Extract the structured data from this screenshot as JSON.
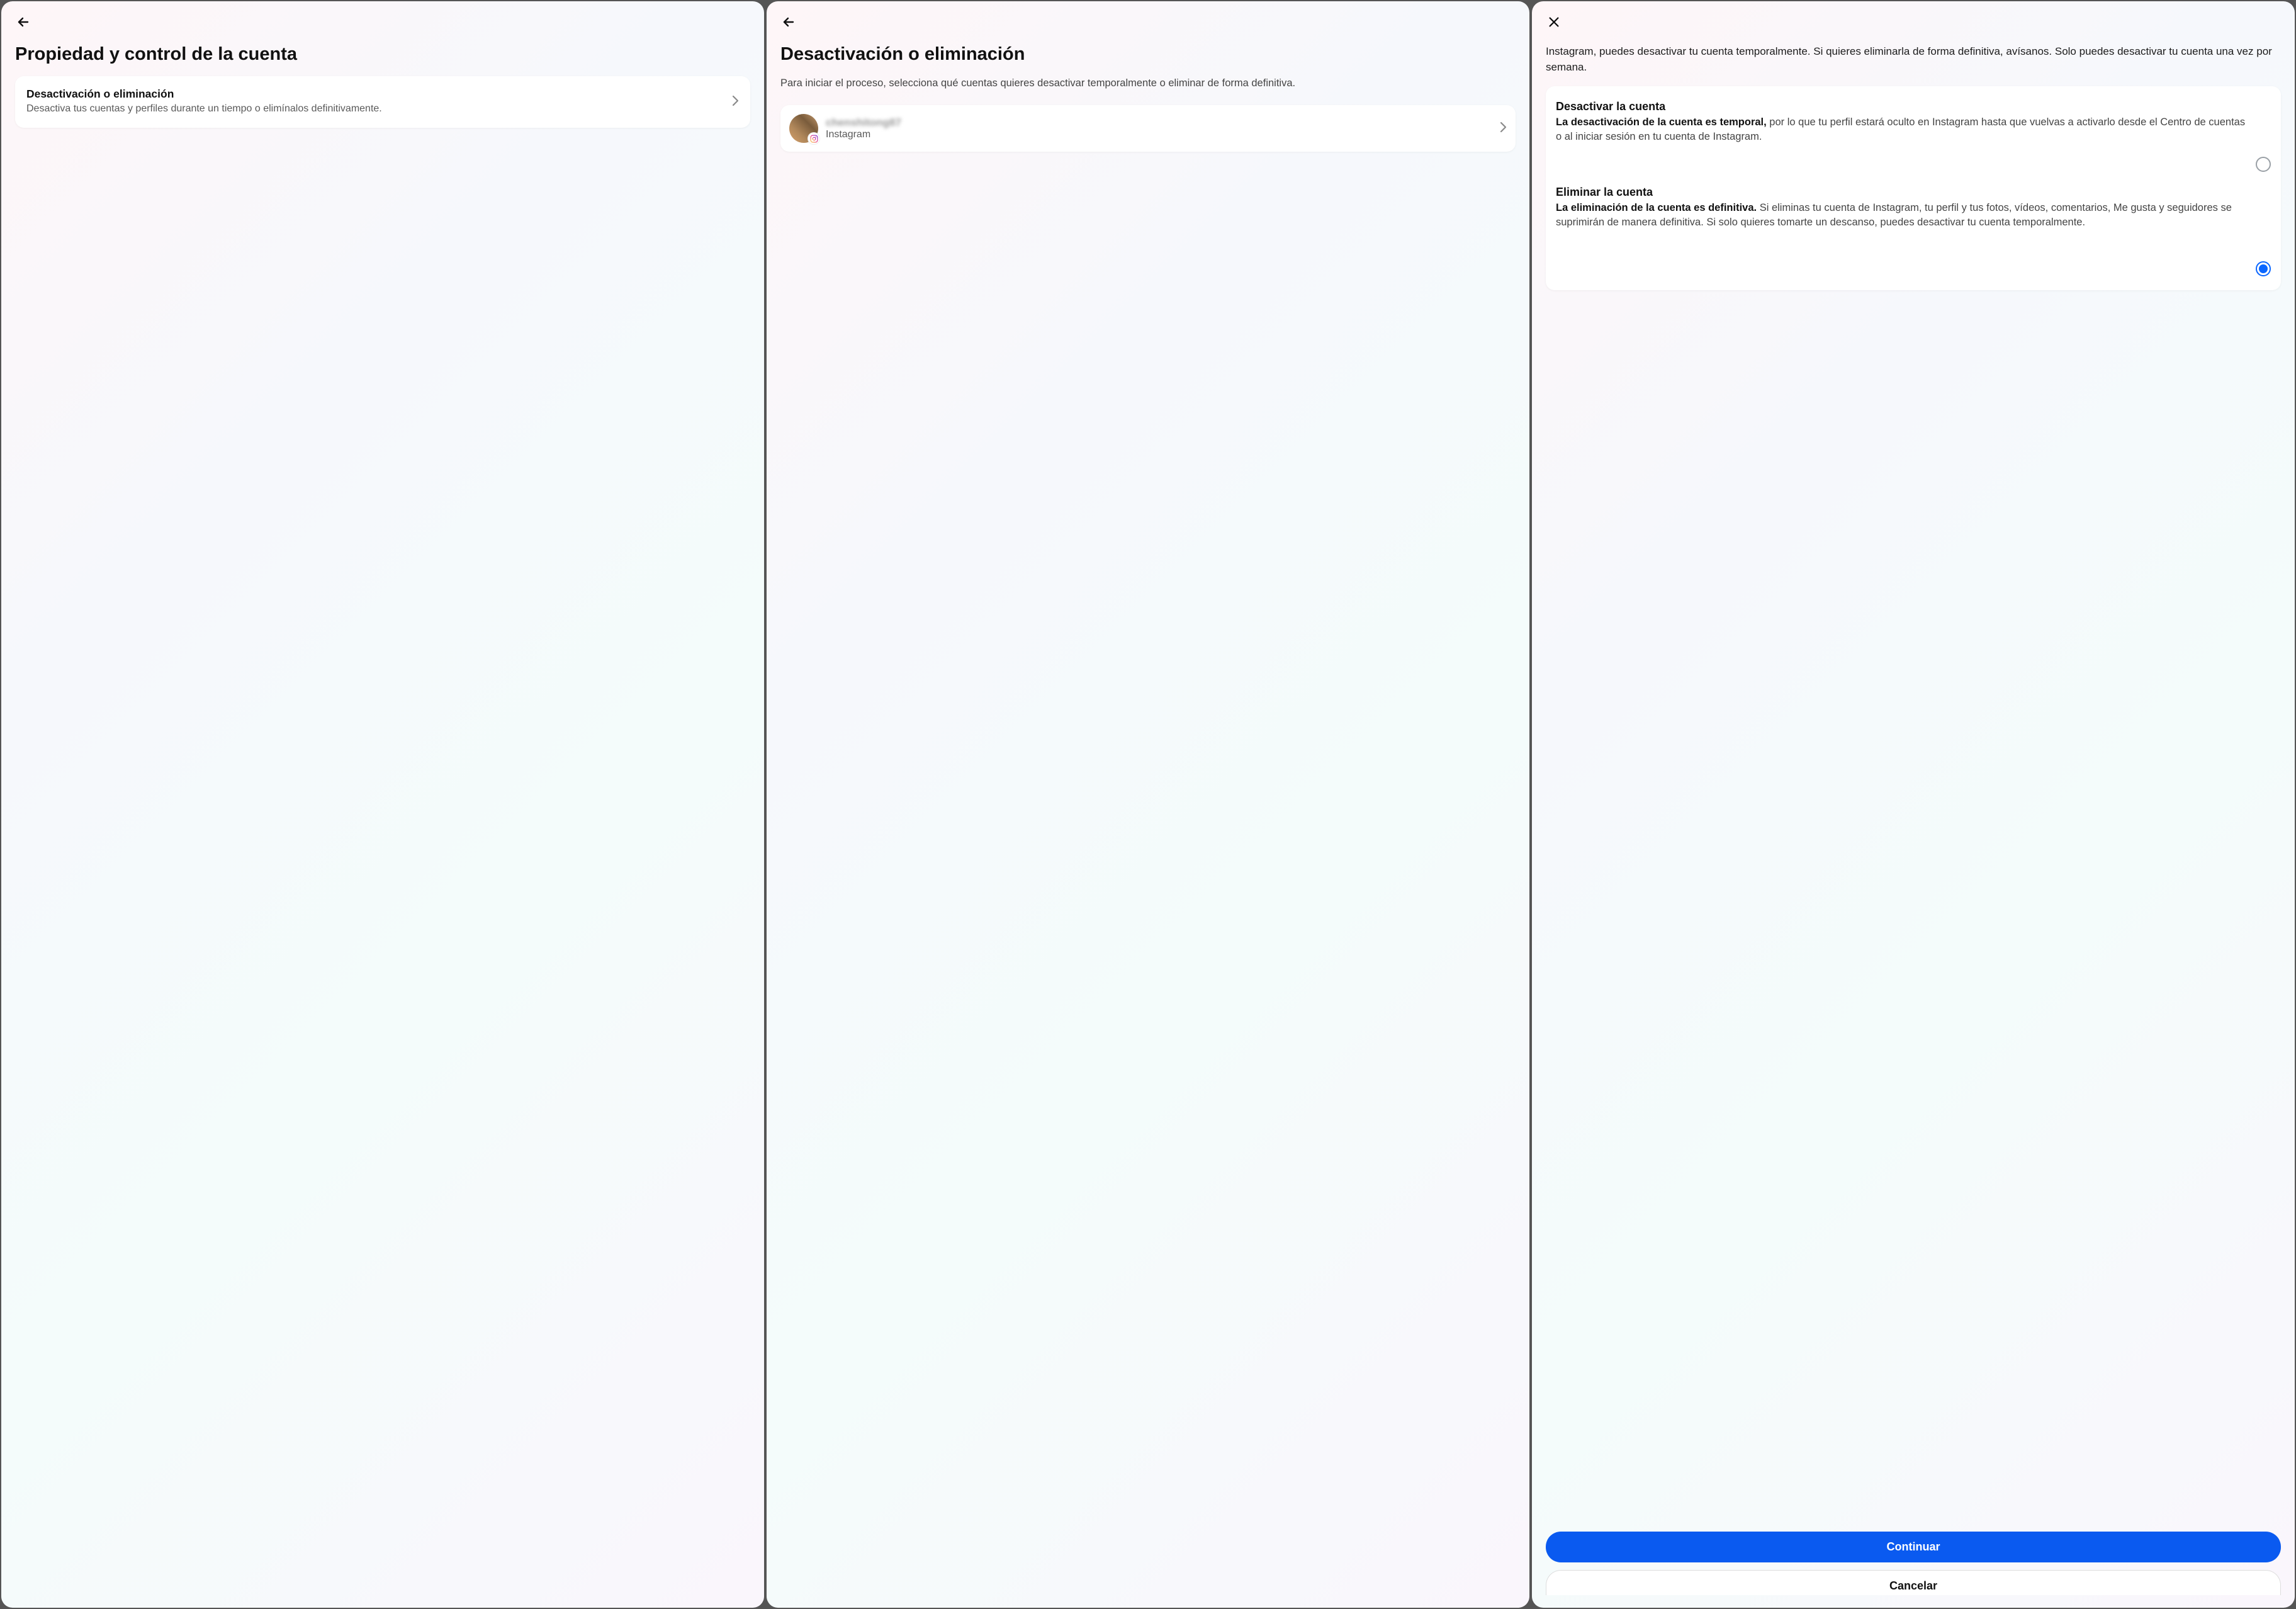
{
  "panel1": {
    "title": "Propiedad y control de la cuenta",
    "item": {
      "title": "Desactivación o eliminación",
      "desc": "Desactiva tus cuentas y perfiles durante un tiempo o elimínalos definitivamente."
    }
  },
  "panel2": {
    "title": "Desactivación o eliminación",
    "subtitle": "Para iniciar el proceso, selecciona qué cuentas quieres desactivar temporalmente o eliminar de forma definitiva.",
    "account": {
      "username": "chenshitong87",
      "platform": "Instagram"
    }
  },
  "panel3": {
    "intro": "Instagram, puedes desactivar tu cuenta temporalmente. Si quieres eliminarla de forma definitiva, avísanos. Solo puedes desactivar tu cuenta una vez por semana.",
    "options": {
      "deactivate": {
        "title": "Desactivar la cuenta",
        "boldLead": "La desactivación de la cuenta es temporal,",
        "rest": " por lo que tu perfil estará oculto en Instagram hasta que vuelvas a activarlo desde el Centro de cuentas o al iniciar sesión en tu cuenta de Instagram.",
        "selected": false
      },
      "delete": {
        "title": "Eliminar la cuenta",
        "boldLead": "La eliminación de la cuenta es definitiva.",
        "rest": " Si eliminas tu cuenta de Instagram, tu perfil y tus fotos, vídeos, comentarios, Me gusta y seguidores se suprimirán de manera definitiva. Si solo quieres tomarte un descanso, puedes desactivar tu cuenta temporalmente.",
        "selected": true
      }
    },
    "buttons": {
      "continue": "Continuar",
      "cancel": "Cancelar"
    }
  }
}
